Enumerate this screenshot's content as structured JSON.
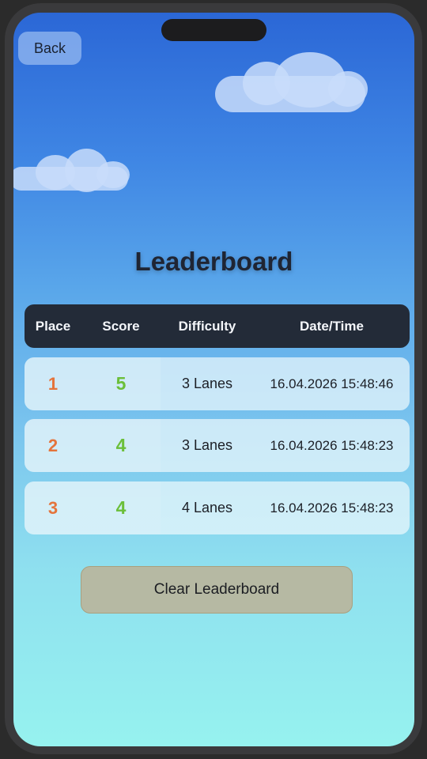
{
  "header": {
    "back_label": "Back"
  },
  "title": "Leaderboard",
  "table": {
    "columns": [
      "Place",
      "Score",
      "Difficulty",
      "Date/Time"
    ],
    "rows": [
      {
        "place": "1",
        "score": "5",
        "difficulty": "3 Lanes",
        "datetime": "16.04.2026 15:48:46"
      },
      {
        "place": "2",
        "score": "4",
        "difficulty": "3 Lanes",
        "datetime": "16.04.2026 15:48:23"
      },
      {
        "place": "3",
        "score": "4",
        "difficulty": "4 Lanes",
        "datetime": "16.04.2026 15:48:23"
      }
    ]
  },
  "actions": {
    "clear_label": "Clear Leaderboard"
  },
  "colors": {
    "place": "#e4743c",
    "score": "#6bbf3a",
    "header_bg": "#232b38",
    "clear_button_bg": "#b6b9a3"
  }
}
